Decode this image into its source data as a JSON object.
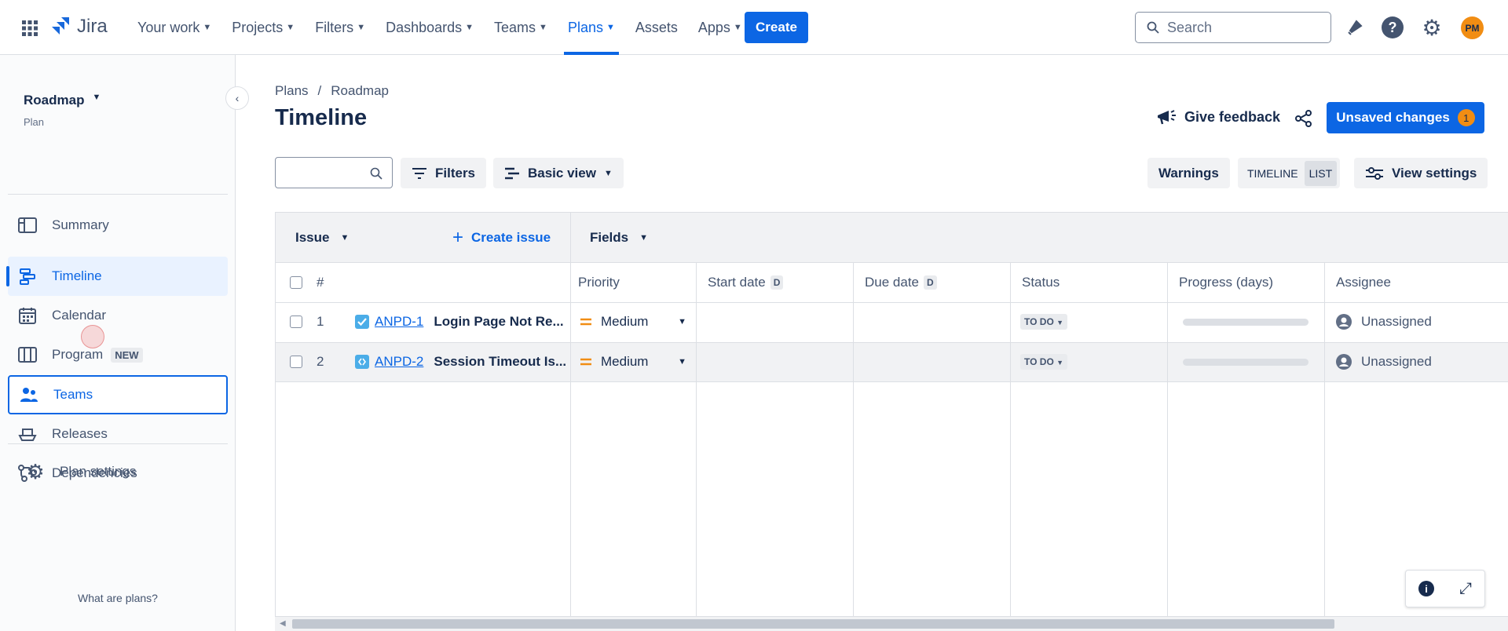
{
  "topnav": {
    "logo": "Jira",
    "items": [
      {
        "label": "Your work",
        "chev": true
      },
      {
        "label": "Projects",
        "chev": true
      },
      {
        "label": "Filters",
        "chev": true
      },
      {
        "label": "Dashboards",
        "chev": true
      },
      {
        "label": "Teams",
        "chev": true
      },
      {
        "label": "Plans",
        "chev": true,
        "active": true
      },
      {
        "label": "Assets",
        "chev": false
      },
      {
        "label": "Apps",
        "chev": true
      }
    ],
    "create": "Create",
    "search_placeholder": "Search",
    "avatar": "PM",
    "accent": "#0c66e4",
    "avatar_color": "#f18d13"
  },
  "sidebar": {
    "title": "Roadmap",
    "subtitle": "Plan",
    "items": [
      {
        "label": "Summary",
        "icon": "summary-icon"
      },
      {
        "label": "Timeline",
        "icon": "timeline-icon",
        "active": true
      },
      {
        "label": "Calendar",
        "icon": "calendar-icon"
      },
      {
        "label": "Program",
        "icon": "program-icon",
        "badge": "NEW"
      },
      {
        "label": "Teams",
        "icon": "teams-icon",
        "focused": true
      },
      {
        "label": "Releases",
        "icon": "releases-icon"
      },
      {
        "label": "Dependencies",
        "icon": "dependencies-icon"
      }
    ],
    "settings": "Plan settings",
    "footer": "What are plans?"
  },
  "main": {
    "breadcrumb": [
      "Plans",
      "Roadmap"
    ],
    "title": "Timeline",
    "give_feedback": "Give feedback",
    "unsaved": "Unsaved changes",
    "unsaved_count": "1",
    "filters": "Filters",
    "basic_view": "Basic view",
    "warnings": "Warnings",
    "timeline_toggle": "TIMELINE",
    "list_toggle": "LIST",
    "view_settings": "View settings"
  },
  "table": {
    "issue_header": "Issue",
    "create_issue": "Create issue",
    "fields": "Fields",
    "hash": "#",
    "columns": [
      "Priority",
      "Start date",
      "Due date",
      "Status",
      "Progress (days)",
      "Assignee"
    ],
    "date_badge": "D",
    "rows": [
      {
        "num": "1",
        "key": "ANPD-1",
        "summary": "Login Page Not Re...",
        "type": "task",
        "priority": "Medium",
        "start": "",
        "due": "",
        "status": "TO DO",
        "progress": 0,
        "assignee": "Unassigned"
      },
      {
        "num": "2",
        "key": "ANPD-2",
        "summary": "Session Timeout Is...",
        "type": "subtask",
        "priority": "Medium",
        "start": "",
        "due": "",
        "status": "TO DO",
        "progress": 0,
        "assignee": "Unassigned"
      }
    ]
  }
}
